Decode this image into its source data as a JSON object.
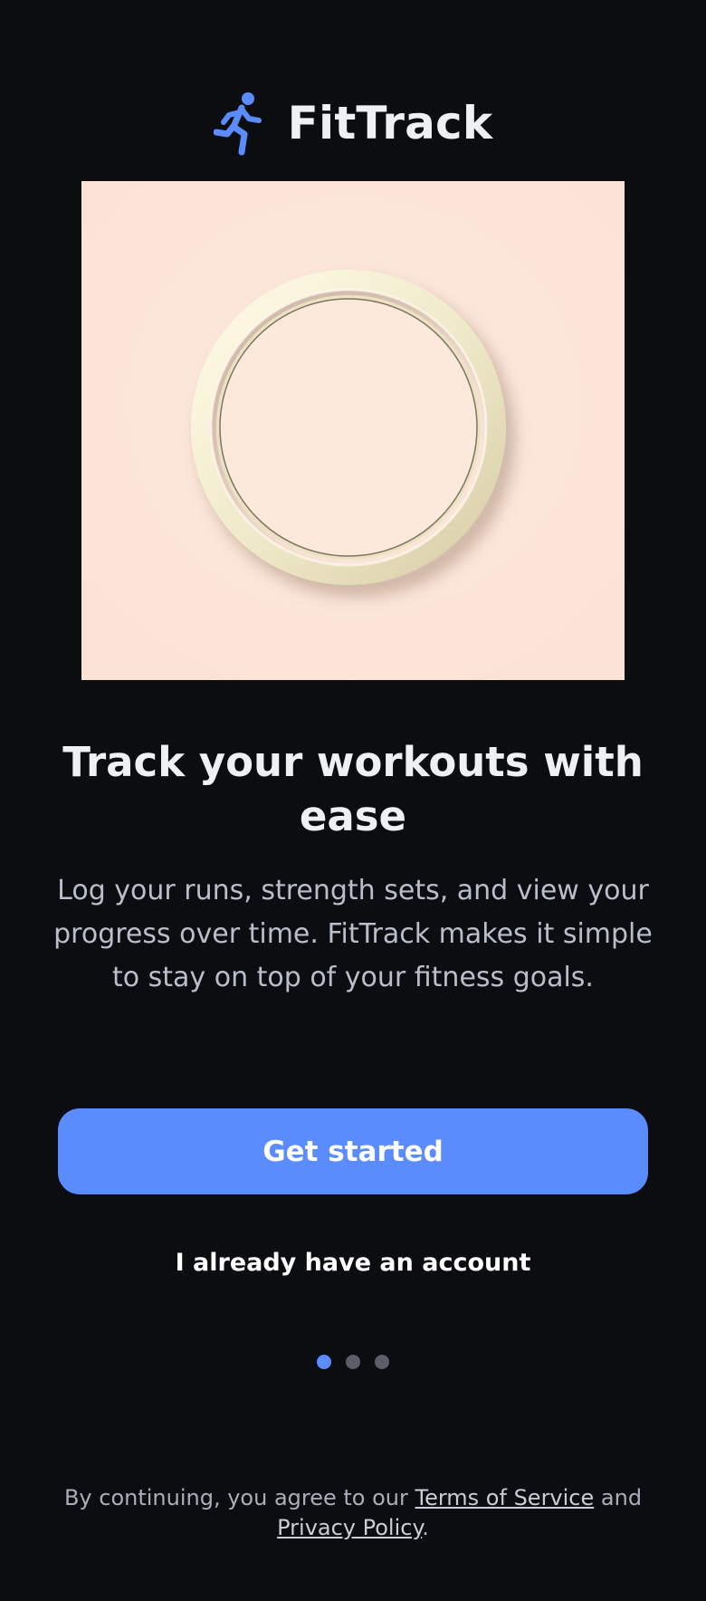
{
  "app": {
    "title": "FitTrack",
    "logo_icon": "running-person-icon",
    "brand_color": "#5b8cfe"
  },
  "hero": {
    "image": "embossed-ring-illustration",
    "background_color": "#fde7da"
  },
  "onboarding": {
    "headline": "Track your workouts with ease",
    "description": "Log your runs, strength sets, and view your progress over time. FitTrack makes it simple to stay on top of your fitness goals."
  },
  "actions": {
    "primary_label": "Get started",
    "secondary_label": "I already have an account"
  },
  "pagination": {
    "total": 3,
    "current": 1,
    "active_color": "#5b8cfe",
    "inactive_color": "#5b5e66"
  },
  "legal": {
    "prefix": "By continuing, you agree to our ",
    "terms_label": "Terms of Service",
    "middle": " and",
    "privacy_label": "Privacy Policy",
    "suffix": "."
  }
}
